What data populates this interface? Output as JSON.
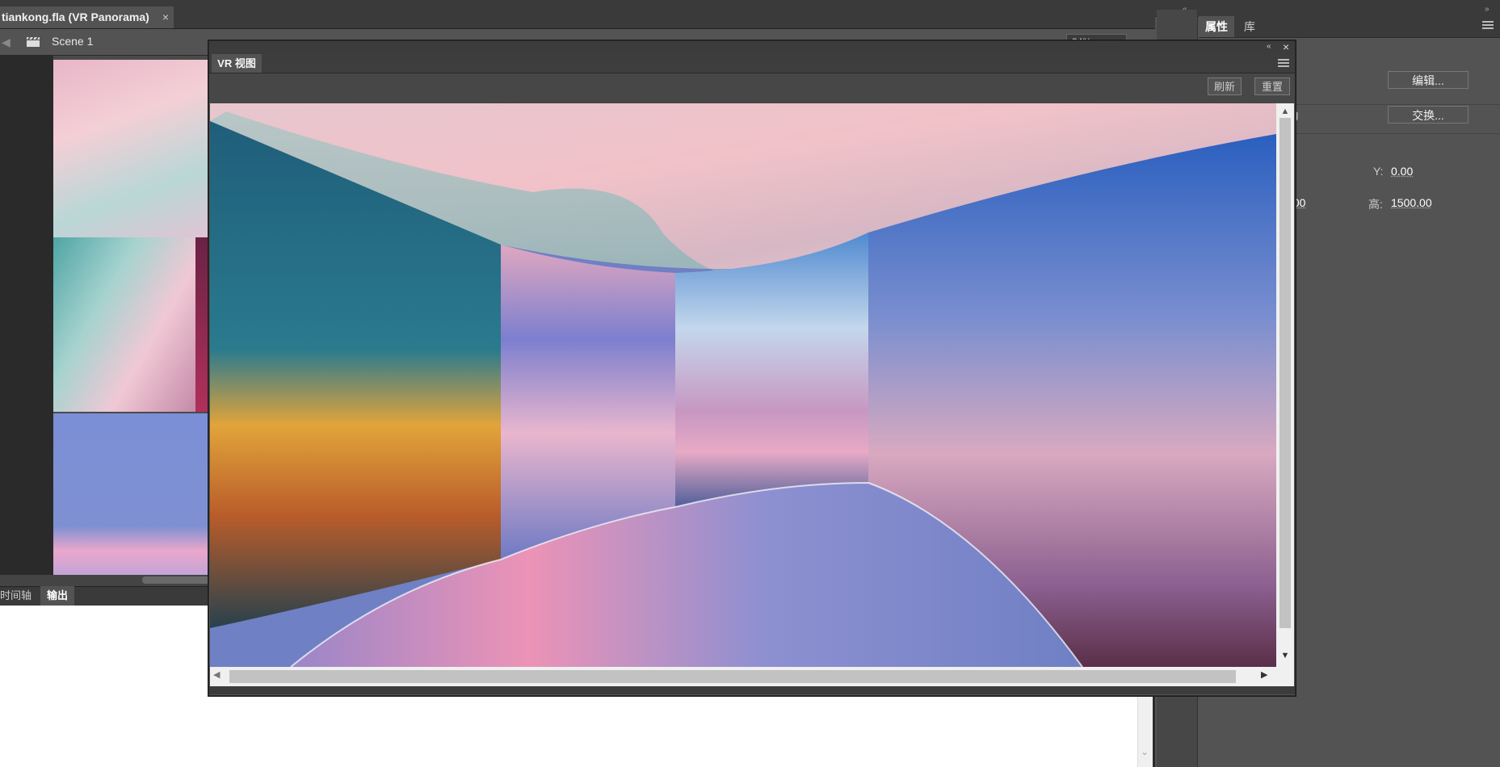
{
  "document": {
    "tab_title": "tiankong.fla (VR Panorama)",
    "tab_close": "×",
    "scene_label": "Scene 1",
    "zoom": "34%"
  },
  "bottom_panel": {
    "tabs": [
      "时间轴",
      "输出"
    ],
    "active_tab": "输出"
  },
  "vr_view": {
    "tab_label": "VR 视图",
    "refresh_label": "刷新",
    "reset_label": "重置",
    "collapse_glyph": "«",
    "close_glyph": "×"
  },
  "properties": {
    "tabs": [
      "属性",
      "库"
    ],
    "edit_button": "编辑...",
    "swap_button": "交换...",
    "partial_filename": "g",
    "y_label": "Y:",
    "y_value": "0.00",
    "w_partial": ".00",
    "h_label": "高:",
    "h_value": "1500.00"
  },
  "icons": {
    "back": "arrow-left-icon",
    "scene": "clapperboard-icon",
    "menu": "hamburger-menu-icon"
  },
  "colors": {
    "panel_bg": "#535353",
    "dark_bar": "#3a3a3a",
    "sky_blue": "#6f80c4"
  }
}
